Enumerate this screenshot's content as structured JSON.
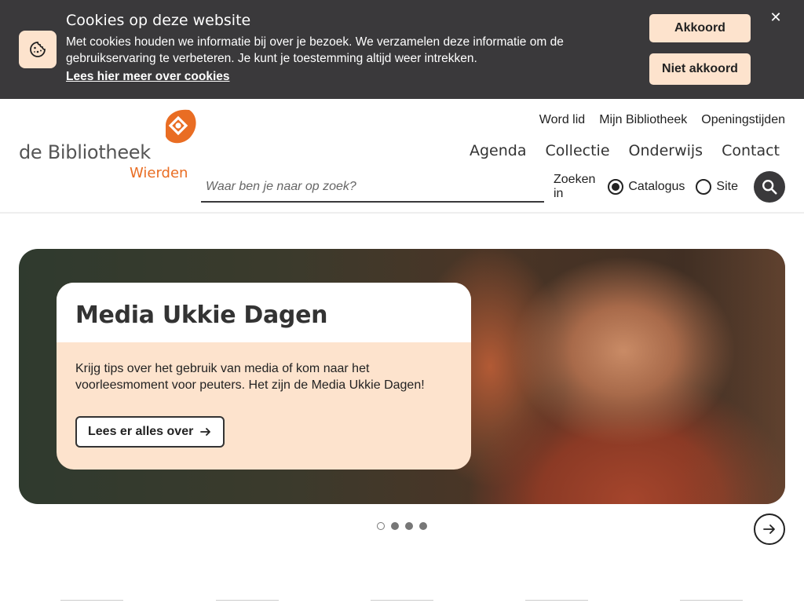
{
  "cookie": {
    "title": "Cookies op deze website",
    "text": "Met cookies houden we informatie bij over je bezoek. We verzamelen deze informatie om de gebruikservaring te verbeteren. Je kunt je toestemming altijd weer intrekken.",
    "link": "Lees hier meer over cookies",
    "accept_label": "Akkoord",
    "decline_label": "Niet akkoord",
    "close_symbol": "✕"
  },
  "logo": {
    "name": "de Bibliotheek",
    "place": "Wierden"
  },
  "top_links": [
    "Word lid",
    "Mijn Bibliotheek",
    "Openingstijden"
  ],
  "main_nav": [
    "Agenda",
    "Collectie",
    "Onderwijs",
    "Contact"
  ],
  "search": {
    "placeholder": "Waar ben je naar op zoek?",
    "scope_label": "Zoeken in",
    "options": [
      "Catalogus",
      "Site"
    ],
    "selected": "Catalogus"
  },
  "hero": {
    "title": "Media Ukkie Dagen",
    "text": "Krijg tips over het gebruik van media of kom naar het voorleesmoment voor peuters. Het zijn de Media Ukkie Dagen!",
    "button_label": "Lees er alles over"
  },
  "carousel": {
    "slide_count": 4,
    "active_index": 0
  },
  "colors": {
    "banner_bg": "#3a393b",
    "peach": "#fde3cd",
    "brand_orange": "#e96d23"
  }
}
